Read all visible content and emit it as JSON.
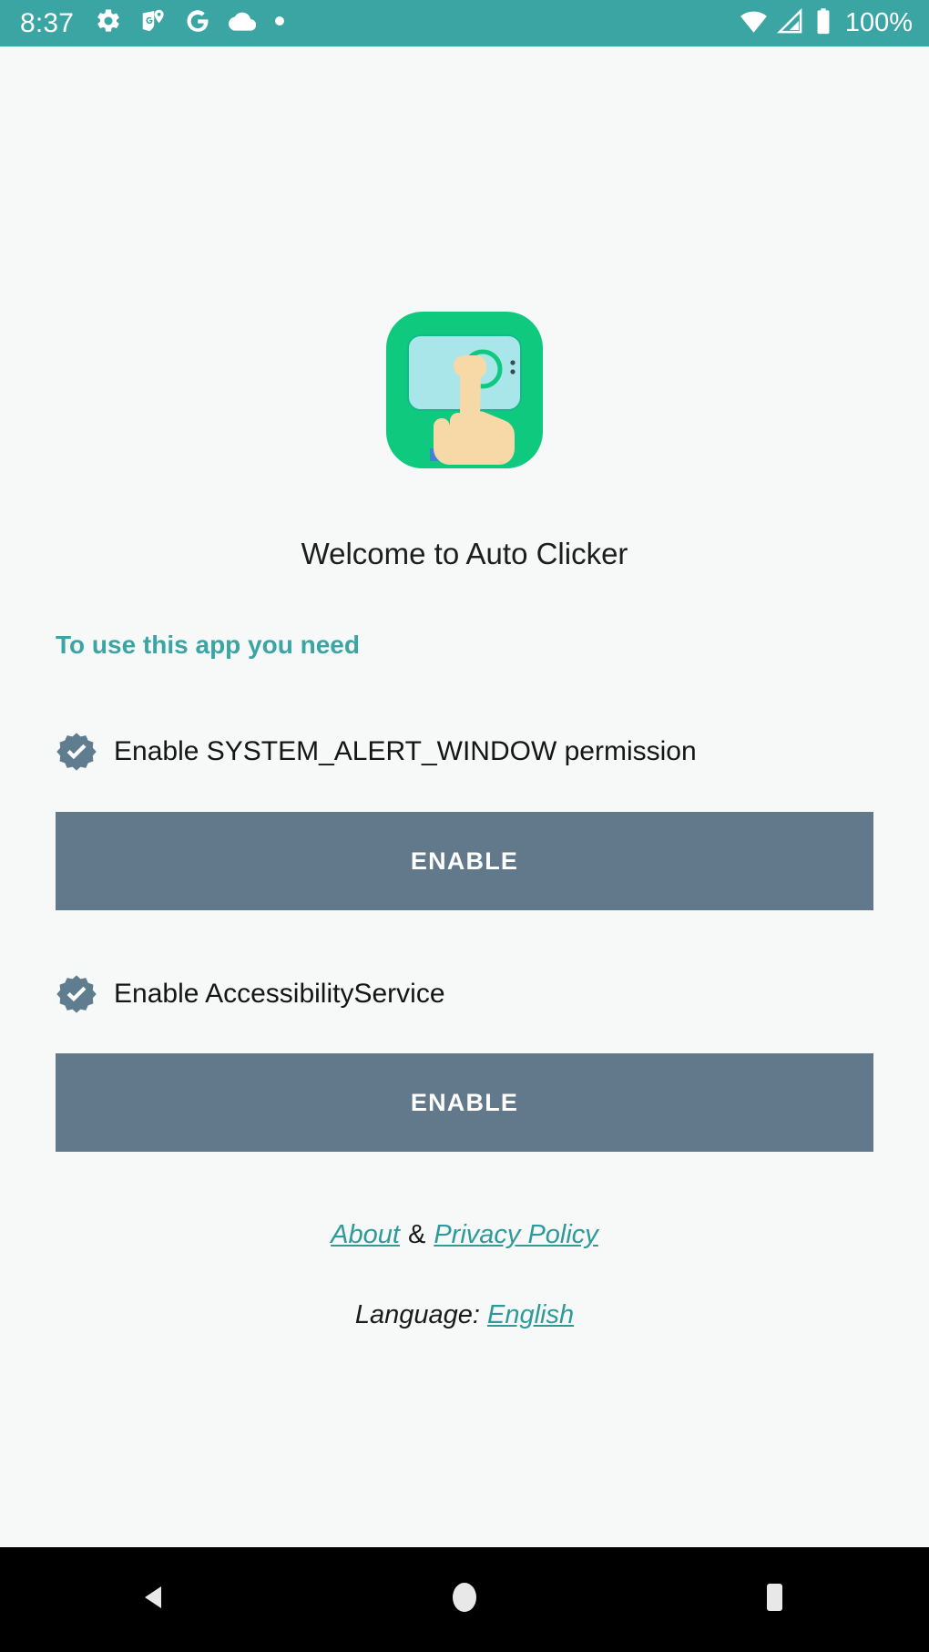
{
  "status_bar": {
    "time": "8:37",
    "battery_percent": "100%",
    "background_color": "#3ba5a4",
    "left_icons": [
      "gear-icon",
      "maps-pin-icon",
      "google-g-icon",
      "cloud-icon",
      "dot-icon"
    ],
    "right_icons": [
      "wifi-icon",
      "cellular-signal-icon",
      "battery-icon"
    ]
  },
  "app": {
    "logo_icon": "auto-clicker-app-logo",
    "welcome_title": "Welcome to Auto Clicker",
    "section_heading": "To use this app you need",
    "accent_color": "#3ba5a4",
    "button_color": "#61798a",
    "background_color": "#f7f8f8",
    "permissions": [
      {
        "icon": "verified-check-badge-icon",
        "label": "Enable SYSTEM_ALERT_WINDOW permission",
        "button_label": "ENABLE"
      },
      {
        "icon": "verified-check-badge-icon",
        "label": "Enable AccessibilityService",
        "button_label": "ENABLE"
      }
    ],
    "footer": {
      "about_link": "About",
      "separator": "&",
      "privacy_link": "Privacy Policy",
      "language_label": "Language:",
      "language_value": "English"
    }
  },
  "nav_bar": {
    "background_color": "#000000",
    "buttons": [
      "back-nav-button",
      "home-nav-button",
      "recents-nav-button"
    ]
  }
}
